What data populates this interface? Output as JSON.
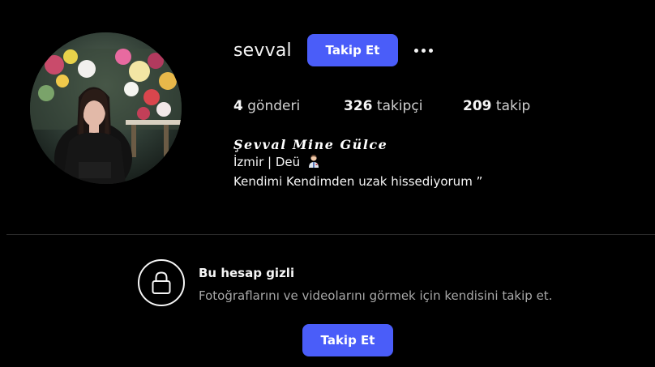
{
  "profile": {
    "username": "sevval",
    "follow_label": "Takip Et",
    "more_icon": "more-horizontal-icon",
    "avatar_icon": "profile-photo"
  },
  "stats": {
    "posts_count": "4",
    "posts_label": "gönderi",
    "followers_count": "326",
    "followers_label": "takipçi",
    "following_count": "209",
    "following_label": "takip"
  },
  "bio": {
    "full_name": "Şevval Mine Gülce",
    "line1": "İzmir | Deü",
    "line1_icon": "person-emoji-icon",
    "line2": "Kendimi Kendimden uzak hissediyorum ”"
  },
  "private_notice": {
    "icon": "lock-icon",
    "title": "Bu hesap gizli",
    "description": "Fotoğraflarını ve videolarını görmek için kendisini takip et.",
    "follow_label": "Takip Et"
  },
  "colors": {
    "background": "#000000",
    "accent": "#4a5df9",
    "text_primary": "#f5f5f5",
    "text_secondary": "#a8a8a8",
    "divider": "#2b2b2b"
  }
}
